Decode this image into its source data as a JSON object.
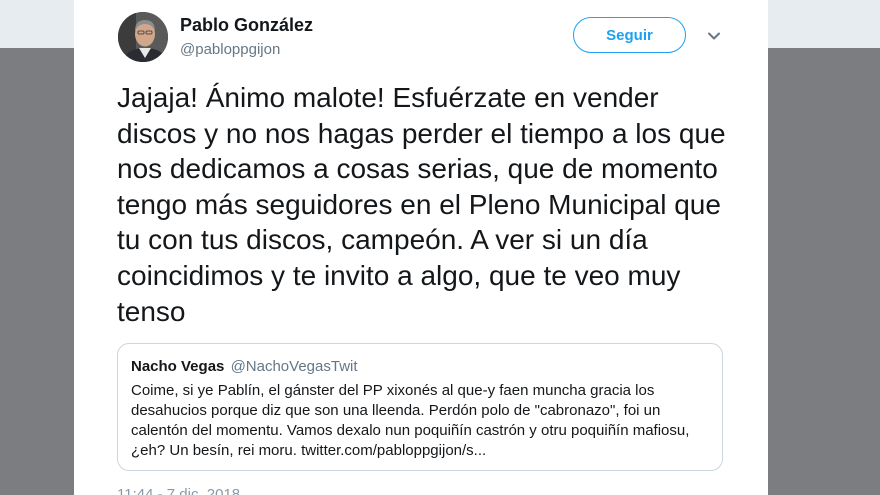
{
  "tweet": {
    "author": {
      "name": "Pablo González",
      "handle": "@pabloppgijon"
    },
    "follow_label": "Seguir",
    "text": "Jajaja! Ánimo malote! Esfuérzate en vender discos y no nos hagas perder el tiempo a los que nos dedicamos a cosas serias, que de momento tengo más seguidores en el Pleno Municipal que tu con tus discos, campeón. A ver si un día coincidimos y te invito a algo, que te veo muy tenso",
    "quoted": {
      "name": "Nacho Vegas",
      "handle": "@NachoVegasTwit",
      "text": "Coime, si ye Pablín, el gánster del PP xixonés al que-y faen muncha gracia los desahucios porque diz que son una lleenda. Perdón polo de \"cabronazo\", foi un calentón del momentu. Vamos dexalo nun poquiñín castrón y otru poquiñín mafiosu, ¿eh? Un besín, rei moru. twitter.com/pabloppgijon/s..."
    },
    "timestamp": "11:44 - 7 dic. 2018"
  },
  "colors": {
    "accent": "#1da1f2",
    "text": "#14171a",
    "muted": "#657786",
    "border": "#ccd6dd",
    "backdrop": "#7b7d80"
  },
  "icons": {
    "caret": "chevron-down-icon"
  }
}
